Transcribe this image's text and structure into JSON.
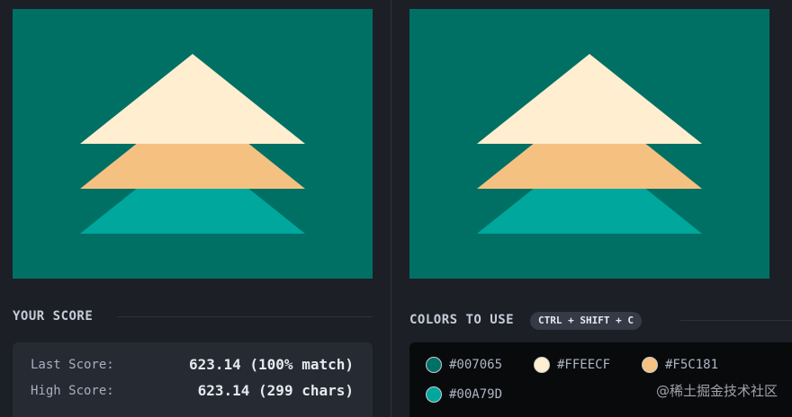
{
  "target": {
    "background": "#007065",
    "layers": [
      {
        "name": "bottom",
        "color": "#00A79D"
      },
      {
        "name": "middle",
        "color": "#F5C181"
      },
      {
        "name": "top",
        "color": "#FFEECF"
      }
    ]
  },
  "score_section": {
    "title": "YOUR SCORE",
    "last_label": "Last Score:",
    "last_value": "623.14 (100% match)",
    "high_label": "High Score:",
    "high_value": "623.14 (299 chars)"
  },
  "colors_section": {
    "title": "COLORS TO USE",
    "shortcut": "CTRL + SHIFT + C",
    "colors": [
      {
        "hex": "#007065",
        "label": "#007065"
      },
      {
        "hex": "#FFEECF",
        "label": "#FFEECF"
      },
      {
        "hex": "#F5C181",
        "label": "#F5C181"
      },
      {
        "hex": "#00A79D",
        "label": "#00A79D"
      }
    ]
  },
  "watermark": "@稀土掘金技术社区"
}
